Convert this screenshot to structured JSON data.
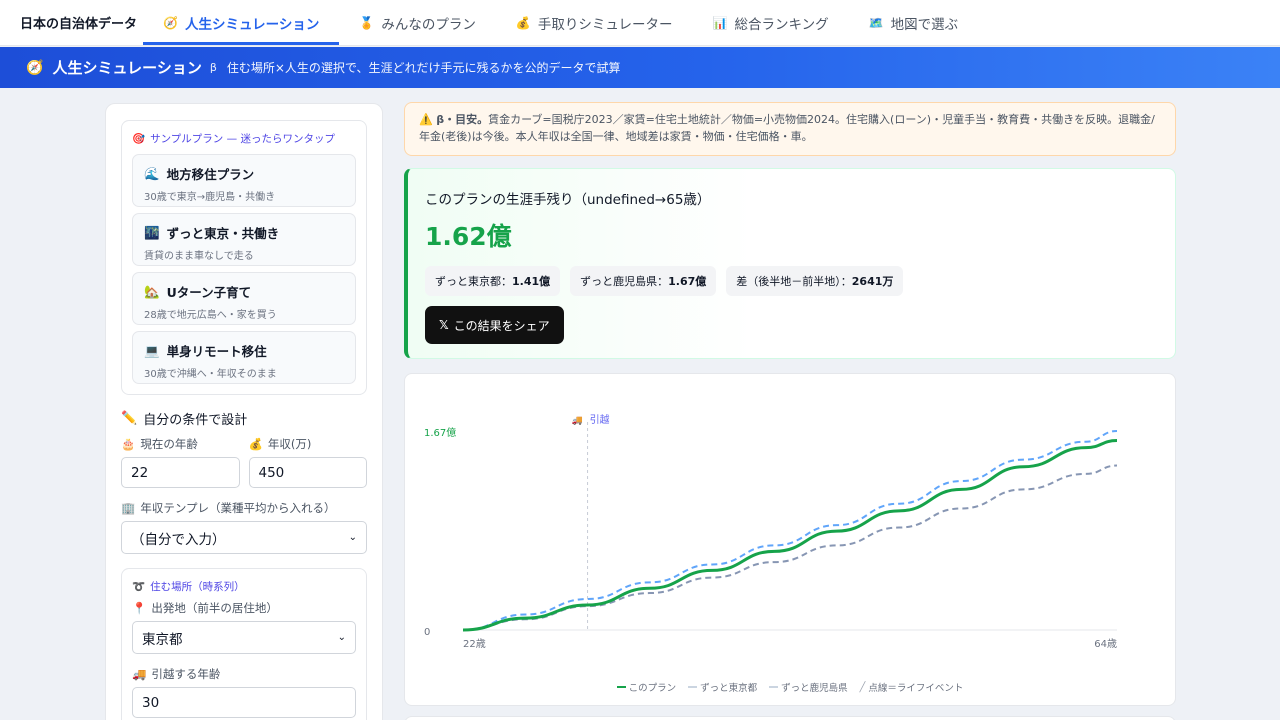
{
  "nav": {
    "brand": "日本の自治体データ",
    "tabs": [
      {
        "icon": "🧭",
        "label": "人生シミュレーション",
        "active": true
      },
      {
        "icon": "🏅",
        "label": "みんなのプラン"
      },
      {
        "icon": "💰",
        "label": "手取りシミュレーター"
      },
      {
        "icon": "📊",
        "label": "総合ランキング"
      },
      {
        "icon": "🗺️",
        "label": "地図で選ぶ"
      }
    ]
  },
  "banner": {
    "icon": "🧭",
    "title": "人生シミュレーション",
    "beta": "β",
    "subtitle": "住む場所×人生の選択で、生涯どれだけ手元に残るかを公的データで試算"
  },
  "samples": {
    "icon": "🎯",
    "heading": "サンプルプラン — 迷ったらワンタップ",
    "items": [
      {
        "icon": "🌊",
        "title": "地方移住プラン",
        "sub": "30歳で東京→鹿児島・共働き"
      },
      {
        "icon": "🌃",
        "title": "ずっと東京・共働き",
        "sub": "賃貸のまま車なしで走る"
      },
      {
        "icon": "🏡",
        "title": "Uターン子育て",
        "sub": "28歳で地元広島へ・家を買う"
      },
      {
        "icon": "💻",
        "title": "単身リモート移住",
        "sub": "30歳で沖縄へ・年収そのまま"
      }
    ]
  },
  "form": {
    "design_icon": "✏️",
    "design_title": "自分の条件で設計",
    "age_icon": "🎂",
    "age_label": "現在の年齢",
    "age_value": "22",
    "income_icon": "💰",
    "income_label": "年収(万)",
    "income_value": "450",
    "template_icon": "🏢",
    "template_label": "年収テンプレ（業種平均から入れる）",
    "template_value": "（自分で入力）",
    "timeline_icon": "➰",
    "timeline_heading": "住む場所（時系列）",
    "origin_icon": "📍",
    "origin_label": "出発地（前半の居住地）",
    "origin_value": "東京都",
    "move_icon": "🚚",
    "move_label": "引越する年齢",
    "move_value": "30"
  },
  "notice": {
    "icon": "⚠️",
    "lead": "β・目安。",
    "text": "賃金カーブ=国税庁2023／家賃=住宅土地統計／物価=小売物価2024。住宅購入(ローン)・児童手当・教育費・共働きを反映。退職金/年金(老後)は今後。本人年収は全国一律、地域差は家賃・物価・住宅価格・車。"
  },
  "result": {
    "title": "このプランの生涯手残り（undefined→65歳）",
    "value": "1.62億",
    "chips": [
      {
        "label": "ずっと東京都：",
        "value": "1.41億"
      },
      {
        "label": "ずっと鹿児島県：",
        "value": "1.67億"
      },
      {
        "label": "差（後半地－前半地）：",
        "value": "2641万"
      }
    ],
    "share_x": "𝕏",
    "share_label": "この結果をシェア"
  },
  "chart_data": {
    "type": "line",
    "x": [
      22,
      26,
      30,
      34,
      38,
      42,
      46,
      50,
      54,
      58,
      62,
      64
    ],
    "series": [
      {
        "name": "このプラン",
        "color": "#16a34a",
        "dash": "solid",
        "values": [
          0,
          0.1,
          0.21,
          0.35,
          0.5,
          0.66,
          0.83,
          1.0,
          1.18,
          1.37,
          1.53,
          1.59
        ]
      },
      {
        "name": "ずっと東京都",
        "color": "#8796b3",
        "dash": "dashed",
        "values": [
          0,
          0.09,
          0.2,
          0.31,
          0.44,
          0.57,
          0.71,
          0.86,
          1.02,
          1.18,
          1.31,
          1.38
        ]
      },
      {
        "name": "ずっと鹿児島県",
        "color": "#60a5fa",
        "dash": "dashed",
        "values": [
          0,
          0.13,
          0.26,
          0.4,
          0.55,
          0.71,
          0.88,
          1.06,
          1.25,
          1.43,
          1.58,
          1.67
        ]
      }
    ],
    "ymax_label": "1.67億",
    "ymin_label": "0",
    "ylim": [
      0,
      1.67
    ],
    "x_start_label": "22歳",
    "x_end_label": "64歳",
    "event": {
      "x": 30,
      "icon": "🚚",
      "label": "引越"
    },
    "legend": [
      {
        "label": "このプラン",
        "color": "#16a34a"
      },
      {
        "label": "ずっと東京都",
        "color": "#cbd5e1"
      },
      {
        "label": "ずっと鹿児島県",
        "color": "#cbd5e1"
      },
      {
        "label": "点線＝ライフイベント",
        "color": "#9ca3af"
      }
    ]
  }
}
